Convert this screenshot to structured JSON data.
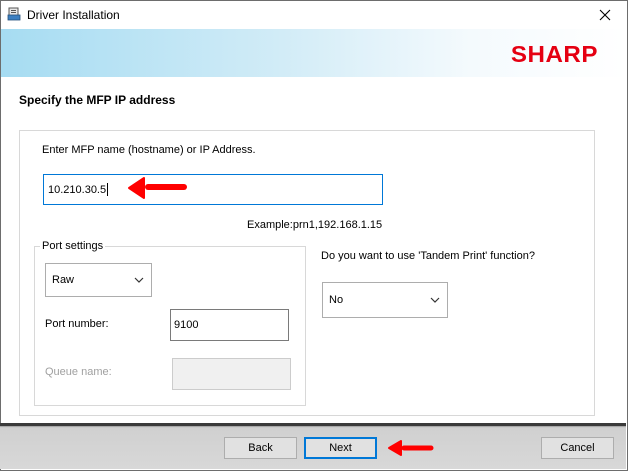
{
  "window": {
    "title": "Driver Installation",
    "brand_logo": "SHARP",
    "brand_color": "#e50012"
  },
  "page": {
    "heading": "Specify the MFP IP address",
    "host_label": "Enter MFP name (hostname) or IP Address.",
    "host_value": "10.210.30.5",
    "example_text": "Example:prn1,192.168.1.15"
  },
  "port_settings": {
    "legend": "Port settings",
    "protocol_selected": "Raw",
    "port_number_label": "Port number:",
    "port_number_value": "9100",
    "queue_name_label": "Queue name:",
    "queue_name_value": ""
  },
  "tandem": {
    "question": "Do you want to use 'Tandem Print' function?",
    "selected": "No"
  },
  "buttons": {
    "back": "Back",
    "next": "Next",
    "cancel": "Cancel"
  },
  "annotation_color": "#ff0000"
}
